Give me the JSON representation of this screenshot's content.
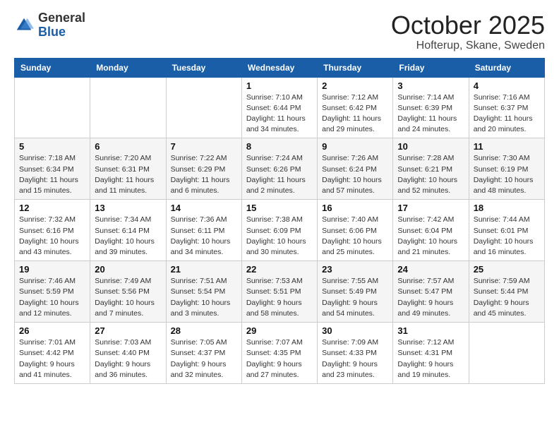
{
  "logo": {
    "general": "General",
    "blue": "Blue"
  },
  "title": "October 2025",
  "location": "Hofterup, Skane, Sweden",
  "days_of_week": [
    "Sunday",
    "Monday",
    "Tuesday",
    "Wednesday",
    "Thursday",
    "Friday",
    "Saturday"
  ],
  "weeks": [
    [
      {
        "day": "",
        "info": ""
      },
      {
        "day": "",
        "info": ""
      },
      {
        "day": "",
        "info": ""
      },
      {
        "day": "1",
        "info": "Sunrise: 7:10 AM\nSunset: 6:44 PM\nDaylight: 11 hours\nand 34 minutes."
      },
      {
        "day": "2",
        "info": "Sunrise: 7:12 AM\nSunset: 6:42 PM\nDaylight: 11 hours\nand 29 minutes."
      },
      {
        "day": "3",
        "info": "Sunrise: 7:14 AM\nSunset: 6:39 PM\nDaylight: 11 hours\nand 24 minutes."
      },
      {
        "day": "4",
        "info": "Sunrise: 7:16 AM\nSunset: 6:37 PM\nDaylight: 11 hours\nand 20 minutes."
      }
    ],
    [
      {
        "day": "5",
        "info": "Sunrise: 7:18 AM\nSunset: 6:34 PM\nDaylight: 11 hours\nand 15 minutes."
      },
      {
        "day": "6",
        "info": "Sunrise: 7:20 AM\nSunset: 6:31 PM\nDaylight: 11 hours\nand 11 minutes."
      },
      {
        "day": "7",
        "info": "Sunrise: 7:22 AM\nSunset: 6:29 PM\nDaylight: 11 hours\nand 6 minutes."
      },
      {
        "day": "8",
        "info": "Sunrise: 7:24 AM\nSunset: 6:26 PM\nDaylight: 11 hours\nand 2 minutes."
      },
      {
        "day": "9",
        "info": "Sunrise: 7:26 AM\nSunset: 6:24 PM\nDaylight: 10 hours\nand 57 minutes."
      },
      {
        "day": "10",
        "info": "Sunrise: 7:28 AM\nSunset: 6:21 PM\nDaylight: 10 hours\nand 52 minutes."
      },
      {
        "day": "11",
        "info": "Sunrise: 7:30 AM\nSunset: 6:19 PM\nDaylight: 10 hours\nand 48 minutes."
      }
    ],
    [
      {
        "day": "12",
        "info": "Sunrise: 7:32 AM\nSunset: 6:16 PM\nDaylight: 10 hours\nand 43 minutes."
      },
      {
        "day": "13",
        "info": "Sunrise: 7:34 AM\nSunset: 6:14 PM\nDaylight: 10 hours\nand 39 minutes."
      },
      {
        "day": "14",
        "info": "Sunrise: 7:36 AM\nSunset: 6:11 PM\nDaylight: 10 hours\nand 34 minutes."
      },
      {
        "day": "15",
        "info": "Sunrise: 7:38 AM\nSunset: 6:09 PM\nDaylight: 10 hours\nand 30 minutes."
      },
      {
        "day": "16",
        "info": "Sunrise: 7:40 AM\nSunset: 6:06 PM\nDaylight: 10 hours\nand 25 minutes."
      },
      {
        "day": "17",
        "info": "Sunrise: 7:42 AM\nSunset: 6:04 PM\nDaylight: 10 hours\nand 21 minutes."
      },
      {
        "day": "18",
        "info": "Sunrise: 7:44 AM\nSunset: 6:01 PM\nDaylight: 10 hours\nand 16 minutes."
      }
    ],
    [
      {
        "day": "19",
        "info": "Sunrise: 7:46 AM\nSunset: 5:59 PM\nDaylight: 10 hours\nand 12 minutes."
      },
      {
        "day": "20",
        "info": "Sunrise: 7:49 AM\nSunset: 5:56 PM\nDaylight: 10 hours\nand 7 minutes."
      },
      {
        "day": "21",
        "info": "Sunrise: 7:51 AM\nSunset: 5:54 PM\nDaylight: 10 hours\nand 3 minutes."
      },
      {
        "day": "22",
        "info": "Sunrise: 7:53 AM\nSunset: 5:51 PM\nDaylight: 9 hours\nand 58 minutes."
      },
      {
        "day": "23",
        "info": "Sunrise: 7:55 AM\nSunset: 5:49 PM\nDaylight: 9 hours\nand 54 minutes."
      },
      {
        "day": "24",
        "info": "Sunrise: 7:57 AM\nSunset: 5:47 PM\nDaylight: 9 hours\nand 49 minutes."
      },
      {
        "day": "25",
        "info": "Sunrise: 7:59 AM\nSunset: 5:44 PM\nDaylight: 9 hours\nand 45 minutes."
      }
    ],
    [
      {
        "day": "26",
        "info": "Sunrise: 7:01 AM\nSunset: 4:42 PM\nDaylight: 9 hours\nand 41 minutes."
      },
      {
        "day": "27",
        "info": "Sunrise: 7:03 AM\nSunset: 4:40 PM\nDaylight: 9 hours\nand 36 minutes."
      },
      {
        "day": "28",
        "info": "Sunrise: 7:05 AM\nSunset: 4:37 PM\nDaylight: 9 hours\nand 32 minutes."
      },
      {
        "day": "29",
        "info": "Sunrise: 7:07 AM\nSunset: 4:35 PM\nDaylight: 9 hours\nand 27 minutes."
      },
      {
        "day": "30",
        "info": "Sunrise: 7:09 AM\nSunset: 4:33 PM\nDaylight: 9 hours\nand 23 minutes."
      },
      {
        "day": "31",
        "info": "Sunrise: 7:12 AM\nSunset: 4:31 PM\nDaylight: 9 hours\nand 19 minutes."
      },
      {
        "day": "",
        "info": ""
      }
    ]
  ]
}
